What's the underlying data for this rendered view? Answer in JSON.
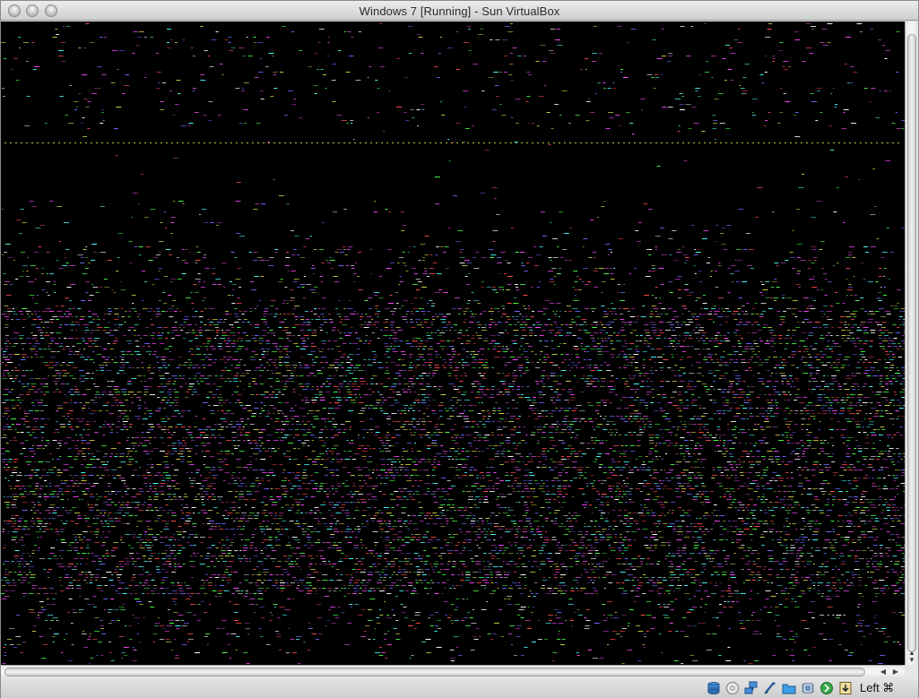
{
  "window": {
    "title": "Windows 7 [Running] - Sun VirtualBox"
  },
  "titlebar": {
    "buttons": [
      "close",
      "minimize",
      "zoom"
    ]
  },
  "vm_display": {
    "state": "garbled-graphics",
    "background": "#000000",
    "noise_colors": [
      "#ff4a4a",
      "#4aff4a",
      "#6a6aff",
      "#ffffff",
      "#ff4aff",
      "#4affff",
      "#d0d040",
      "#c040c0"
    ]
  },
  "statusbar": {
    "icons": [
      {
        "name": "hard-disk-icon"
      },
      {
        "name": "optical-drive-icon"
      },
      {
        "name": "network-icon"
      },
      {
        "name": "usb-icon"
      },
      {
        "name": "shared-folders-icon"
      },
      {
        "name": "virtualization-icon"
      },
      {
        "name": "mouse-integration-icon"
      },
      {
        "name": "keyboard-capture-icon"
      }
    ],
    "host_key_label": "Left ⌘"
  }
}
